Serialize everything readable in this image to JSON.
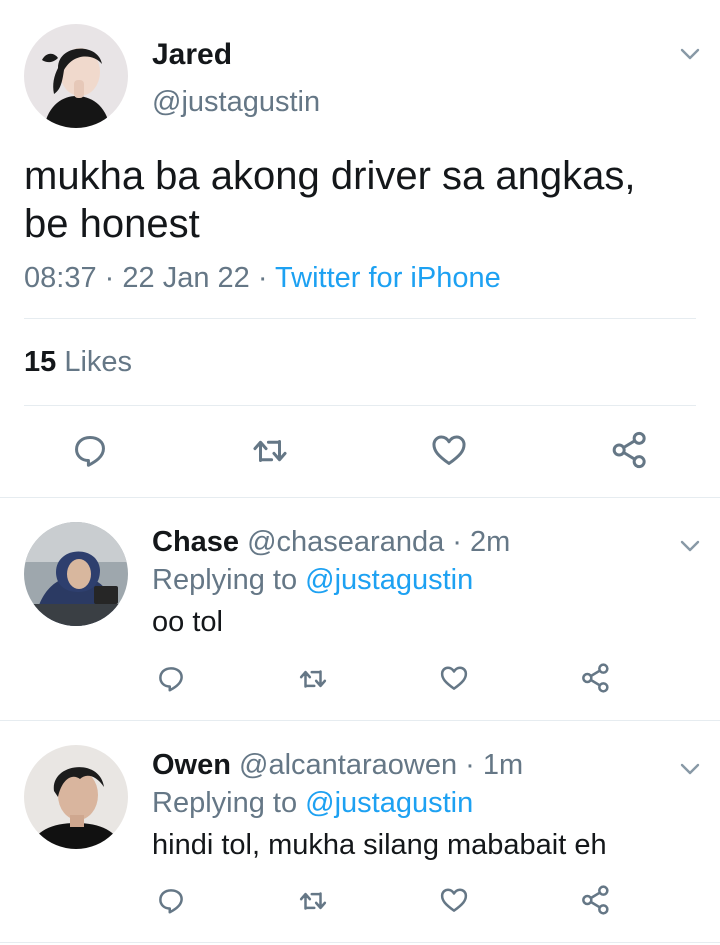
{
  "main_tweet": {
    "author_name": "Jared",
    "author_handle": "@justagustin",
    "text_line1": "mukha ba akong driver sa angkas,",
    "text_line2": "be honest",
    "time": "08:37",
    "date": "22 Jan 22",
    "source": "Twitter for iPhone",
    "likes_count": "15",
    "likes_label": "Likes"
  },
  "replies": [
    {
      "name": "Chase",
      "handle": "@chasearanda",
      "time": "2m",
      "replying_label": "Replying to",
      "replying_handle": "@justagustin",
      "text": "oo tol"
    },
    {
      "name": "Owen",
      "handle": "@alcantaraowen",
      "time": "1m",
      "replying_label": "Replying to",
      "replying_handle": "@justagustin",
      "text": "hindi tol, mukha silang mababait eh"
    }
  ],
  "separator_dot": "·",
  "icons": [
    "reply-icon",
    "retweet-icon",
    "like-icon",
    "share-icon",
    "chevron-down-icon"
  ],
  "colors": {
    "link": "#1da1f2",
    "secondary_text": "#657786",
    "icon": "#657786",
    "divider": "#e6ecf0"
  }
}
